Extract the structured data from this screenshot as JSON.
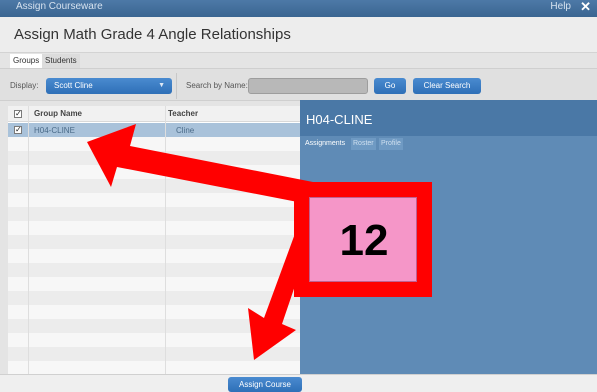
{
  "window": {
    "title": "Assign Courseware",
    "help_label": "Help",
    "close_glyph": "✕"
  },
  "header": {
    "title": "Assign Math Grade 4 Angle Relationships"
  },
  "tabs": [
    {
      "label": "Groups",
      "active": true
    },
    {
      "label": "Students",
      "active": false
    }
  ],
  "toolbar": {
    "display_label": "Display:",
    "display_value": "Scott Cline",
    "search_label": "Search by Name:",
    "search_value": "",
    "go_label": "Go",
    "clear_label": "Clear Search"
  },
  "grid": {
    "columns": [
      "Group Name",
      "Teacher"
    ],
    "rows": [
      {
        "group": "H04-CLINE",
        "teacher": "Cline",
        "checked": true,
        "selected": true
      }
    ],
    "header_checked": true
  },
  "detail": {
    "title": "H04-CLINE",
    "tabs": [
      {
        "label": "Assignments",
        "active": true
      },
      {
        "label": "Roster",
        "active": false
      },
      {
        "label": "Profile",
        "active": false
      }
    ]
  },
  "footer": {
    "assign_label": "Assign Course"
  },
  "annotation": {
    "number": "12",
    "arrow_color": "#ff0000",
    "callout_fill": "#f596c8"
  },
  "colors": {
    "accent": "#2e6fb7",
    "titlebar": "#3a6591",
    "detail_panel": "#5f8bb6",
    "selected_row": "#a9c2da"
  }
}
